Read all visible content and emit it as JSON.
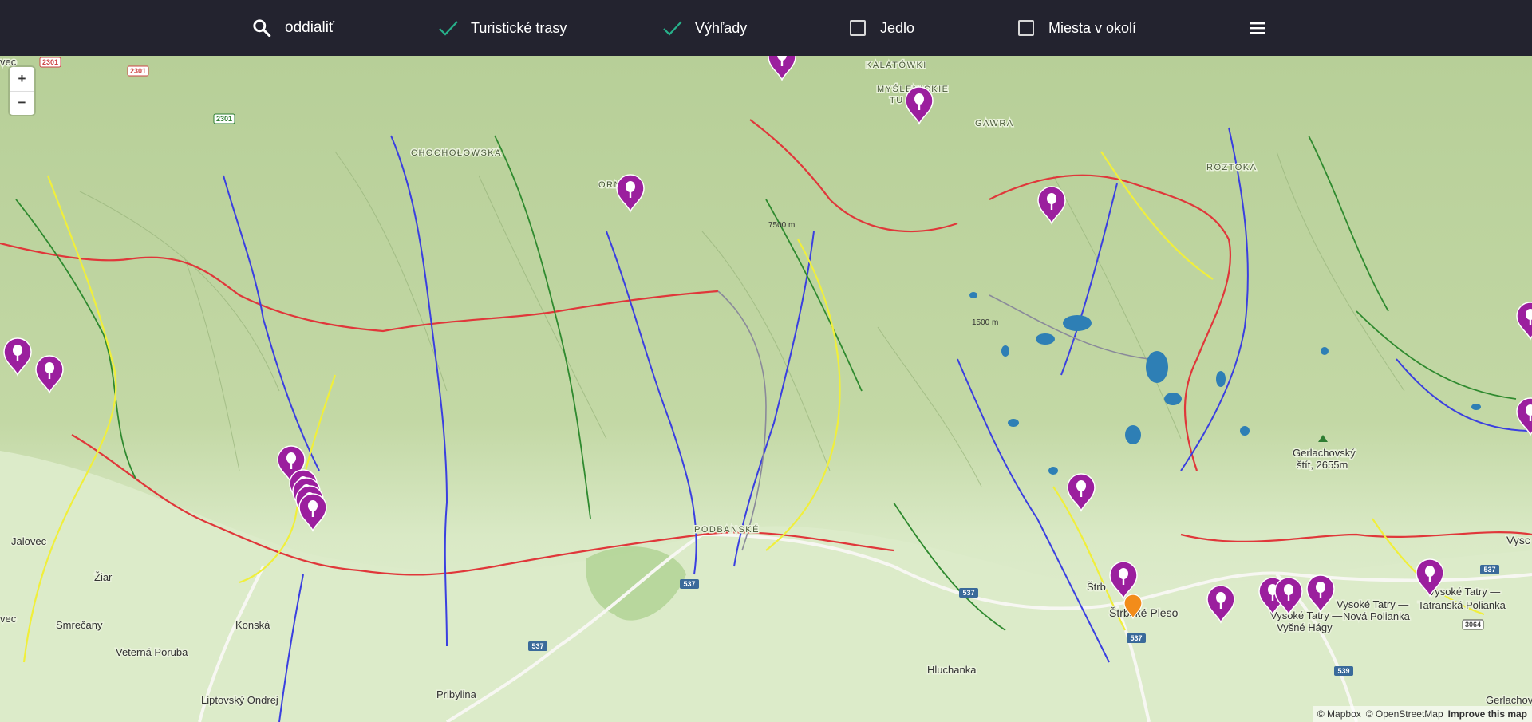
{
  "toolbar": {
    "search_value": "oddialiť",
    "filters": [
      {
        "label": "Turistické trasy",
        "checked": true
      },
      {
        "label": "Výhľady",
        "checked": true
      },
      {
        "label": "Jedlo",
        "checked": false
      },
      {
        "label": "Miesta v okolí",
        "checked": false
      }
    ],
    "menu_icon": "hamburger-menu-icon"
  },
  "map": {
    "zoom_in": "+",
    "zoom_out": "−",
    "places": {
      "chocholowska": "CHOCHOŁOWSKA",
      "kalatowki": "KALATÓWKI",
      "myslenickie_1": "MYŚLENICKIE",
      "myslenickie_2": "TU",
      "gawra": "GAWRA",
      "roztoka": "ROZTOKA",
      "orn": "ORN",
      "podbanske": "PODBANSKÉ",
      "jalovec": "Jalovec",
      "ziar": "Žiar",
      "smrecany": "Smrečany",
      "konska": "Konská",
      "veterna_poruba": "Veterná Poruba",
      "liptovsky_ondrej": "Liptovský Ondrej",
      "pribylina": "Pribylina",
      "hluchanka": "Hluchanka",
      "strbske_pleso": "Štrbské Pleso",
      "strbske_small": "Štrb",
      "vysoke_hagy_1": "Vysoké Tatry —",
      "vysoke_hagy_2": "Vyšné Hágy",
      "nova_polianka_1": "Vysoké Tatry —",
      "nova_polianka_2": "Nová Polianka",
      "tatranska_polianka_1": "Vysoké Tatry —",
      "tatranska_polianka_2": "Tatranská Polianka",
      "gerlachovsky_1": "Gerlachovský",
      "gerlachovsky_2": "štít, 2655m",
      "gerlachov": "Gerlachov",
      "vysoke_edge": "Vysc",
      "vec_edge": "vec",
      "vec_edge2": "vec",
      "elev_1": "7500 m",
      "elev_2": "1500 m"
    },
    "road_shields": [
      "2301",
      "2301",
      "2301",
      "537",
      "537",
      "537",
      "537",
      "537",
      "539",
      "3064"
    ],
    "viewpoint_icon": "viewpoint-pin-icon",
    "current_location_icon": "location-pin-icon",
    "viewpoint_count": 22
  },
  "attribution": {
    "mapbox": "© Mapbox",
    "osm": "© OpenStreetMap",
    "improve": "Improve this map"
  },
  "colors": {
    "toolbar_bg": "#23232f",
    "check_green": "#27b08a",
    "pin_purple": "#9b1f9e",
    "trail_red": "#e0373a",
    "trail_blue": "#3a3fe0",
    "trail_green": "#2f8a2f",
    "trail_yellow": "#f0ef3b",
    "lake": "#2e7fb5"
  }
}
